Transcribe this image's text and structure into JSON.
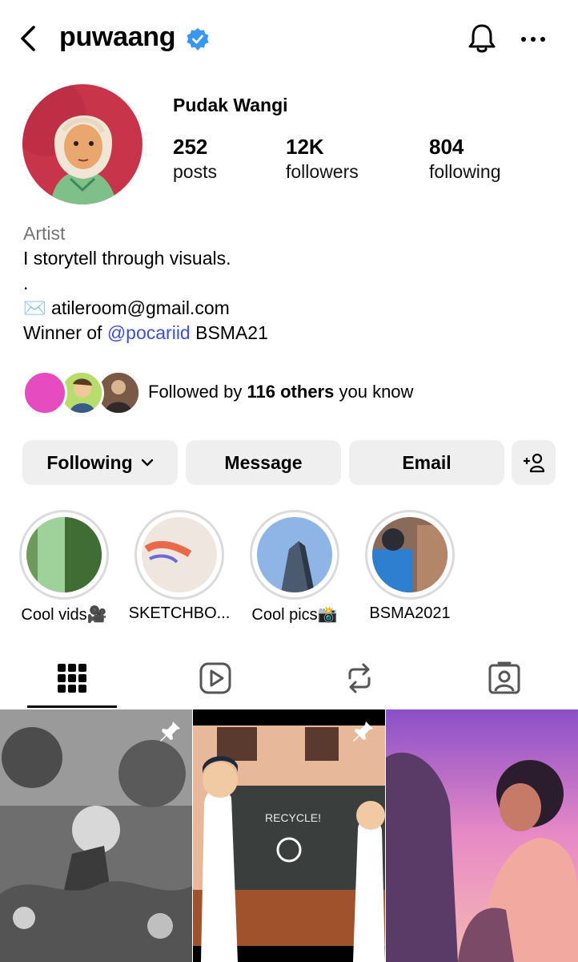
{
  "header": {
    "username": "puwaang",
    "icons": {
      "back": "back-arrow-icon",
      "verified": "verified-badge-icon",
      "bell": "bell-icon",
      "more": "more-options-icon"
    }
  },
  "profile": {
    "full_name": "Pudak Wangi",
    "stats": [
      {
        "value": "252",
        "label": "posts"
      },
      {
        "value": "12K",
        "label": "followers"
      },
      {
        "value": "804",
        "label": "following"
      }
    ],
    "bio": {
      "category": "Artist",
      "line1": "I storytell through visuals.",
      "line2": ".",
      "email_prefix": "✉️",
      "email": "atileroom@gmail.com",
      "winner_prefix": "Winner of",
      "winner_mention": "@pocariid",
      "winner_suffix": "BSMA21"
    },
    "followed_by": {
      "prefix": "Followed by",
      "count": "116 others",
      "suffix": "you know"
    }
  },
  "actions": {
    "following": "Following",
    "message": "Message",
    "email": "Email",
    "add_user_icon": "add-person-icon"
  },
  "highlights": [
    {
      "label": "Cool vids🎥"
    },
    {
      "label": "SKETCHBO..."
    },
    {
      "label": "Cool pics📸"
    },
    {
      "label": "BSMA2021"
    }
  ],
  "tabs": [
    {
      "icon": "grid-icon",
      "active": true
    },
    {
      "icon": "reels-icon",
      "active": false
    },
    {
      "icon": "reposts-icon",
      "active": false
    },
    {
      "icon": "tagged-icon",
      "active": false
    }
  ],
  "colors": {
    "verified": "#3897f0",
    "mention": "#3d4fd4",
    "button_bg": "#efefef",
    "category": "#737373"
  }
}
